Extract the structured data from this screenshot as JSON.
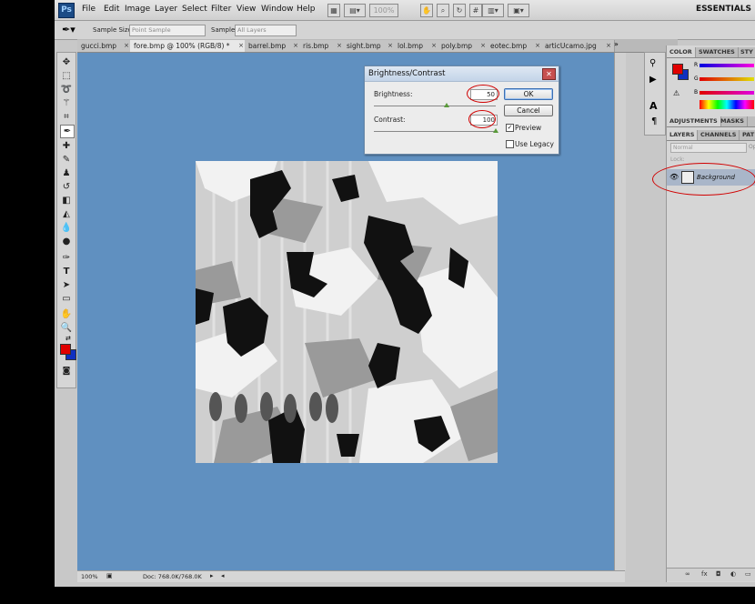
{
  "app": {
    "logo": "Ps"
  },
  "menu": {
    "items": [
      "File",
      "Edit",
      "Image",
      "Layer",
      "Select",
      "Filter",
      "View",
      "Window",
      "Help"
    ],
    "zoom": "100%",
    "workspace": "ESSENTIALS"
  },
  "options": {
    "sample_size_label": "Sample Size:",
    "sample_size_value": "Point Sample",
    "sample_label": "Sample:",
    "sample_value": "All Layers"
  },
  "tabs": [
    {
      "label": "gucci.bmp"
    },
    {
      "label": "fore.bmp @ 100% (RGB/8) *"
    },
    {
      "label": "barrel.bmp"
    },
    {
      "label": "ris.bmp"
    },
    {
      "label": "sight.bmp"
    },
    {
      "label": "lol.bmp"
    },
    {
      "label": "poly.bmp"
    },
    {
      "label": "eotec.bmp"
    },
    {
      "label": "articUcamo.jpg"
    }
  ],
  "tab_overflow": "»",
  "status": {
    "zoom": "100%",
    "doc": "Doc: 768.0K/768.0K"
  },
  "dialog": {
    "title": "Brightness/Contrast",
    "brightness_label": "Brightness:",
    "brightness_value": "50",
    "contrast_label": "Contrast:",
    "contrast_value": "100",
    "ok_label": "OK",
    "cancel_label": "Cancel",
    "preview_label": "Preview",
    "legacy_label": "Use Legacy",
    "preview_checked": true,
    "legacy_checked": false,
    "brightness_level": 0.6,
    "contrast_level": 1.0
  },
  "panels": {
    "color_tabs": [
      "COLOR",
      "SWATCHES",
      "STY"
    ],
    "channels": [
      "R",
      "G",
      "B"
    ],
    "adjust_tabs": [
      "ADJUSTMENTS",
      "MASKS"
    ],
    "layer_tabs": [
      "LAYERS",
      "CHANNELS",
      "PAT"
    ],
    "blend_mode": "Normal",
    "opacity_label": "Op",
    "lock_label": "Lock:",
    "layer_name": "Background"
  },
  "colors": {
    "canvas_bg": "#6090c0",
    "foreground": "#e00000",
    "background": "#1030c0",
    "annotation": "#d00000"
  }
}
